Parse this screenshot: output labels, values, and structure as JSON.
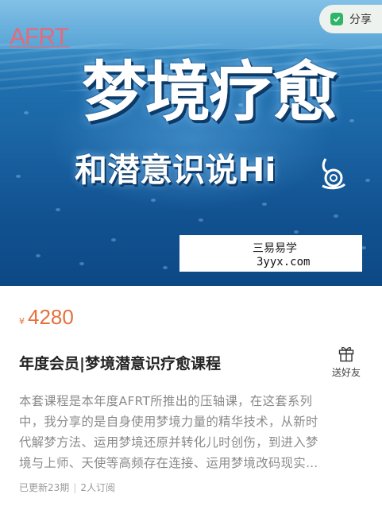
{
  "hero": {
    "logo": "AFRT",
    "title_line1": "梦境疗愈",
    "title_line2": "和潜意识说Hi",
    "share_label": "分享",
    "watermark_line1": "三易易学",
    "watermark_line2": "3yyx.com"
  },
  "course": {
    "currency": "¥",
    "price": "4280",
    "title": "年度会员|梦境潜意识疗愈课程",
    "gift_label": "送好友",
    "description_lines": [
      "本套课程是本年度AFRT所推出的压轴课，在这套系列",
      "中，我分享的是自身使用梦境力量的精华技术，从新时",
      "代解梦方法、运用梦境还原并转化儿时创伤，到进入梦",
      "境与上师、天使等高频存在连接、运用梦境改码现实…"
    ],
    "updated": "已更新23期",
    "subscribers": "2人订阅"
  },
  "colors": {
    "accent_price": "#e5703c",
    "share_icon": "#2fb56a",
    "logo": "#e56a7a"
  }
}
